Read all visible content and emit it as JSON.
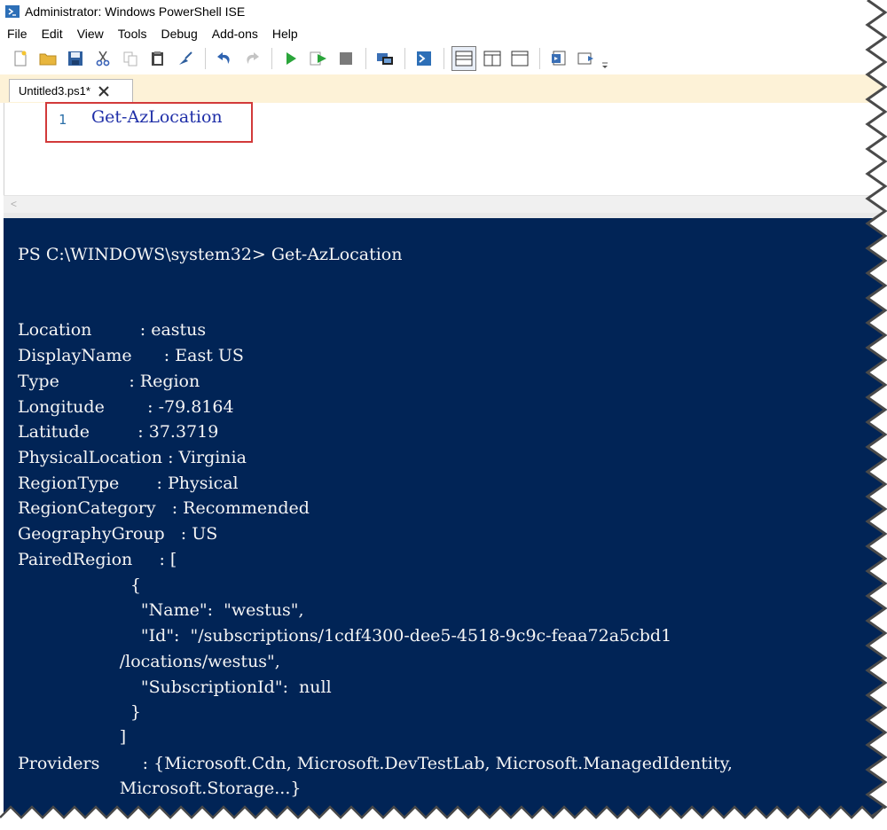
{
  "window": {
    "title": "Administrator: Windows PowerShell ISE"
  },
  "menu": [
    "File",
    "Edit",
    "View",
    "Tools",
    "Debug",
    "Add-ons",
    "Help"
  ],
  "toolbar_icons": [
    "new-file-icon",
    "open-folder-icon",
    "save-icon",
    "cut-icon",
    "copy-icon",
    "paste-icon",
    "clear-icon",
    "undo-icon",
    "redo-icon",
    "run-icon",
    "run-selection-icon",
    "stop-icon",
    "remote-icon",
    "powershell-icon",
    "pane-layout-top-icon",
    "pane-layout-right-icon",
    "pane-layout-max-icon",
    "command-addon-icon",
    "script-pane-icon",
    "toolbar-more-icon"
  ],
  "tab": {
    "label": "Untitled3.ps1*"
  },
  "editor": {
    "line_number": "1",
    "code": "Get-AzLocation"
  },
  "console": {
    "lines": [
      "PS C:\\WINDOWS\\system32> Get-AzLocation",
      "",
      "",
      "Location         : eastus",
      "DisplayName      : East US",
      "Type             : Region",
      "Longitude        : -79.8164",
      "Latitude         : 37.3719",
      "PhysicalLocation : Virginia",
      "RegionType       : Physical",
      "RegionCategory   : Recommended",
      "GeographyGroup   : US",
      "PairedRegion     : [",
      "                     {",
      "                       \"Name\":  \"westus\",",
      "                       \"Id\":  \"/subscriptions/1cdf4300-dee5-4518-9c9c-feaa72a5cbd1",
      "                   /locations/westus\",",
      "                       \"SubscriptionId\":  null",
      "                     }",
      "                   ]",
      "Providers        : {Microsoft.Cdn, Microsoft.DevTestLab, Microsoft.ManagedIdentity,",
      "                   Microsoft.Storage...}"
    ]
  },
  "colors": {
    "console_bg": "#012456",
    "console_fg": "#f5f5f5",
    "highlight": "#d23a3a",
    "tabstrip": "#fdf2d7"
  }
}
